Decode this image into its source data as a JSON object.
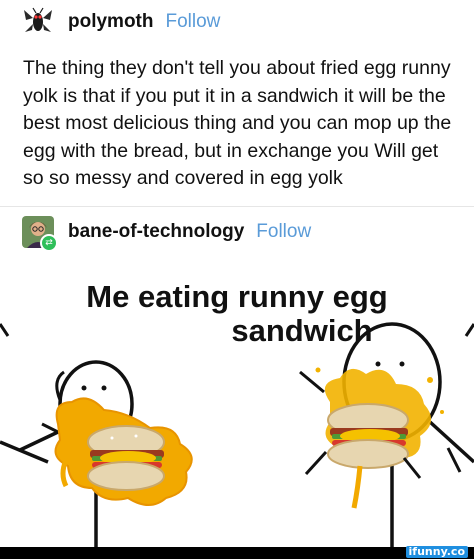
{
  "post1": {
    "username": "polymoth",
    "follow_label": "Follow",
    "text": "The thing they don't tell you about fried egg runny yolk is that if you put it in a sandwich it will be the best most delicious thing and you can mop up the egg with the bread, but in exchange you Will get so so messy and covered in egg yolk"
  },
  "post2": {
    "username": "bane-of-technology",
    "follow_label": "Follow"
  },
  "meme": {
    "caption_line1": "Me eating runny egg",
    "caption_line2": "sandwich"
  },
  "watermark": "ifunny.co",
  "colors": {
    "follow": "#5a9bd8",
    "yolk": "#f2a900",
    "reblog_badge": "#2fbf5a"
  },
  "icons": {
    "post1_avatar": "moth-avatar-icon",
    "post2_avatar": "user-avatar-icon",
    "reblog": "reblog-icon"
  }
}
